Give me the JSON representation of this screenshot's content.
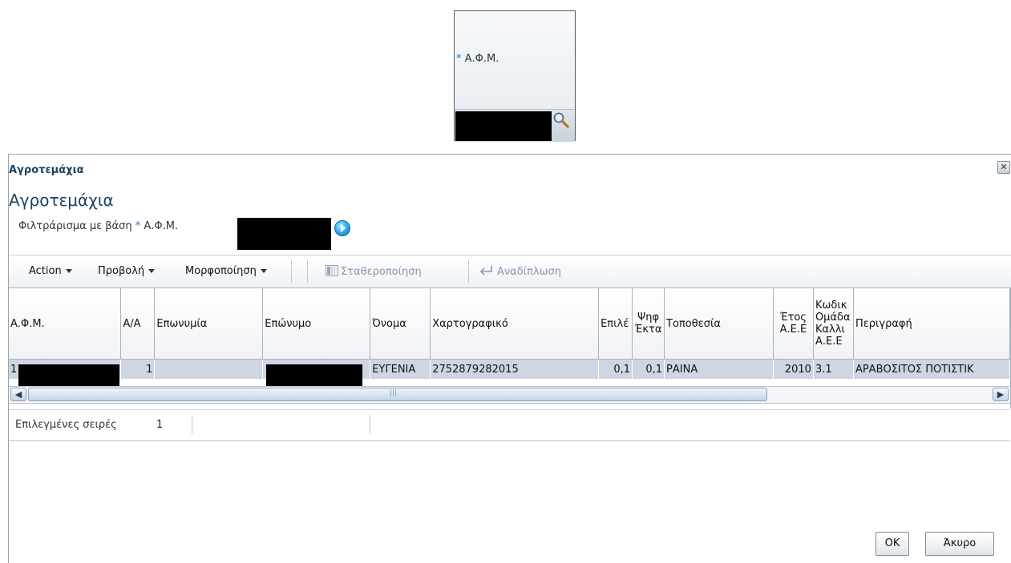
{
  "field_widget": {
    "required_mark": "*",
    "label": "Α.Φ.Μ.",
    "search_icon": "magnifier-icon"
  },
  "dialog": {
    "title": "Αγροτεμάχια",
    "close_icon": "close-icon",
    "header": "Αγροτεμάχια",
    "filter": {
      "prefix": "Φιλτράρισμα με βάση",
      "required_mark": "*",
      "label": "Α.Φ.Μ.",
      "go_icon": "go-arrow-icon"
    },
    "toolbar": {
      "action": "Action",
      "view": "Προβολή",
      "format": "Μορφοποίηση",
      "freeze": "Σταθεροποίηση",
      "wrap": "Αναδίπλωση"
    },
    "table": {
      "columns": [
        "Α.Φ.Μ.",
        "Α/Α",
        "Επωνυμία",
        "Επώνυμο",
        "Όνομα",
        "Χαρτογραφικό",
        "Επιλέ",
        "Ψηφ Έκτα",
        "Τοποθεσία",
        "Έτος Α.Ε.Ε",
        "Κωδικ Ομάδα Καλλι Α.Ε.Ε",
        "Περιγραφή"
      ],
      "rows": [
        [
          "1",
          "1",
          "",
          "",
          "ΕΥΓΕΝΙΑ",
          "2752879282015",
          "0,1",
          "0,1",
          "ΡΑΙΝΑ",
          "2010",
          "3.1",
          "ΑΡΑΒΟΣΙΤΟΣ ΠΟΤΙΣΤΙΚ"
        ]
      ]
    },
    "scrollbar": {
      "left_icon": "scroll-left-icon",
      "right_icon": "scroll-right-icon",
      "grip": "|||"
    },
    "status": {
      "label": "Επιλεγμένες σειρές",
      "count": "1"
    },
    "buttons": {
      "ok": "OK",
      "cancel": "Άκυρο"
    }
  }
}
